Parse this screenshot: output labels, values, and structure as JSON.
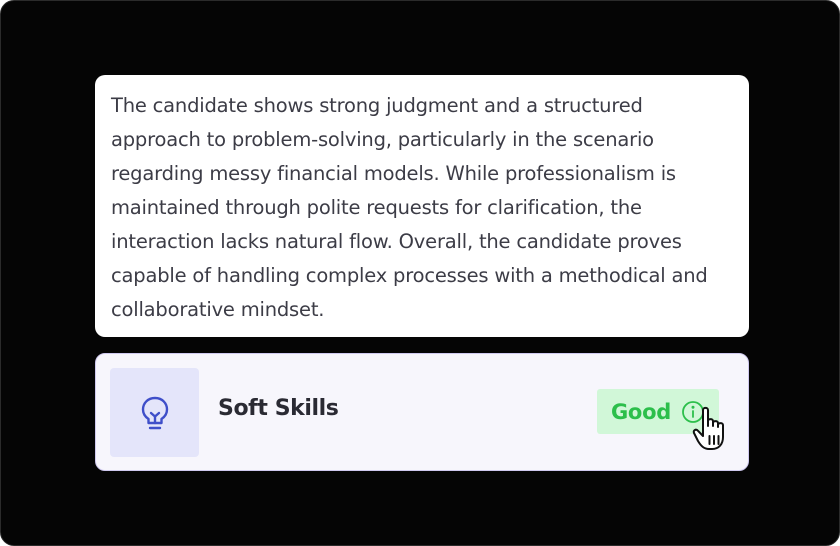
{
  "summary": {
    "text": "The candidate shows strong judgment and a structured approach to problem-solving, particularly in the scenario regarding messy financial models. While professionalism is maintained through polite requests for clarification, the interaction lacks natural flow. Overall, the candidate proves capable of handling complex processes with a methodical and collaborative mindset."
  },
  "skill": {
    "icon": "lightbulb-icon",
    "name": "Soft Skills",
    "rating": "Good",
    "rating_icon": "info-icon"
  },
  "colors": {
    "background": "#050505",
    "card": "#ffffff",
    "skill_row_bg": "#f7f6fc",
    "skill_row_border": "#cfc9ef",
    "icon_tile": "#e4e5fa",
    "icon_stroke": "#3f4fc9",
    "badge_bg": "#d1f7d8",
    "badge_text": "#2cbf4b"
  }
}
